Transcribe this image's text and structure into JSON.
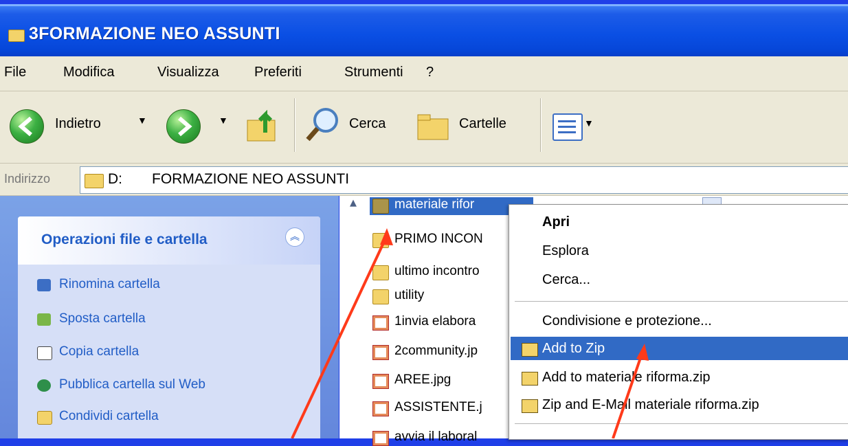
{
  "window": {
    "title": "3FORMAZIONE NEO ASSUNTI"
  },
  "menu": [
    "File",
    "Modifica",
    "Visualizza",
    "Preferiti",
    "Strumenti",
    "?"
  ],
  "toolbar": {
    "back_label": "Indietro",
    "search_label": "Cerca",
    "folders_label": "Cartelle",
    "views_icon": "views-icon"
  },
  "address": {
    "label": "Indirizzo",
    "drive": "D:",
    "path": "FORMAZIONE NEO ASSUNTI"
  },
  "task_pane": {
    "title": "Operazioni file e cartella",
    "tasks": [
      {
        "label": "Rinomina cartella",
        "icon": "rename-icon"
      },
      {
        "label": "Sposta cartella",
        "icon": "move-icon"
      },
      {
        "label": "Copia cartella",
        "icon": "copy-icon"
      },
      {
        "label": "Pubblica cartella sul Web",
        "icon": "web-publish-icon"
      },
      {
        "label": "Condividi cartella",
        "icon": "share-folder-icon"
      }
    ]
  },
  "files": [
    {
      "name": "materiale rifor",
      "type": "folder",
      "selected": true
    },
    {
      "name": "PRIMO INCON",
      "type": "folder"
    },
    {
      "name": "ultimo incontro",
      "type": "folder"
    },
    {
      "name": "utility",
      "type": "folder"
    },
    {
      "name": "1invia elabora",
      "type": "image"
    },
    {
      "name": "2community.jp",
      "type": "image"
    },
    {
      "name": "AREE.jpg",
      "type": "image"
    },
    {
      "name": "ASSISTENTE.j",
      "type": "image"
    },
    {
      "name": "avvia il laboral",
      "type": "image"
    }
  ],
  "context_menu": {
    "items": [
      "Apri",
      "Esplora",
      "Cerca...",
      "Condivisione e protezione...",
      "Add to Zip",
      "Add to materiale riforma.zip",
      "Zip and E-Mail materiale riforma.zip"
    ],
    "highlighted": "Add to Zip"
  },
  "colors": {
    "titlebar": "#0a4fe4",
    "selection": "#316ac5",
    "task_text": "#215dc6",
    "arrow": "#ff3a1a",
    "background": "#1f3fe8"
  }
}
